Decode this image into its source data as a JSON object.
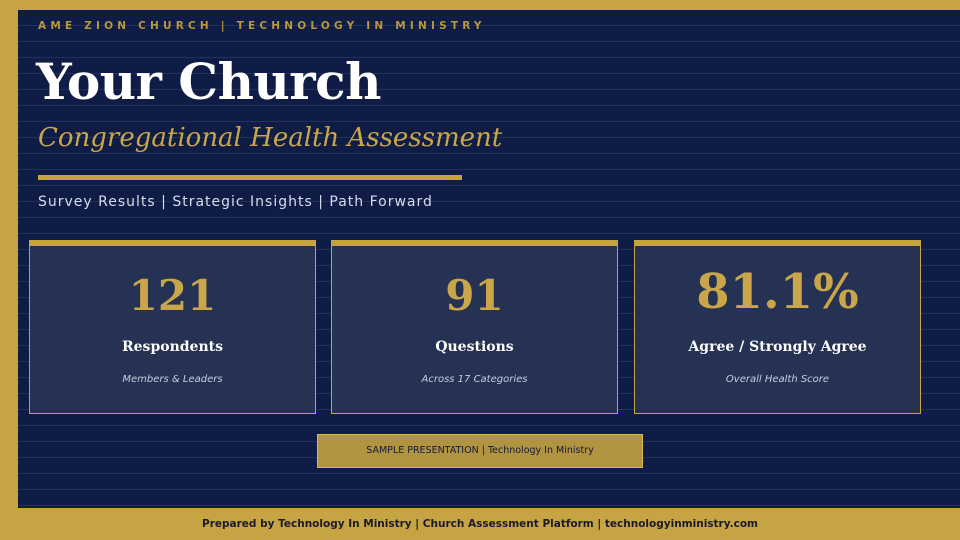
{
  "header": {
    "kicker": "AME ZION CHURCH   |   TECHNOLOGY IN MINISTRY",
    "title": "Your Church",
    "subtitle": "Congregational Health Assessment",
    "tagline": "Survey Results  |  Strategic Insights  |  Path Forward"
  },
  "stats": [
    {
      "value": "121",
      "label": "Respondents",
      "sub": "Members & Leaders"
    },
    {
      "value": "91",
      "label": "Questions",
      "sub": "Across 17 Categories"
    },
    {
      "value": "81.1%",
      "label": "Agree / Strongly Agree",
      "sub": "Overall Health Score"
    }
  ],
  "badge": "SAMPLE PRESENTATION  |  Technology In Ministry",
  "footer": "Prepared by Technology In Ministry  |  Church Assessment Platform  |  technologyinministry.com",
  "colors": {
    "navy": "#0f1c45",
    "gold": "#c6a444",
    "card": "#253253"
  }
}
